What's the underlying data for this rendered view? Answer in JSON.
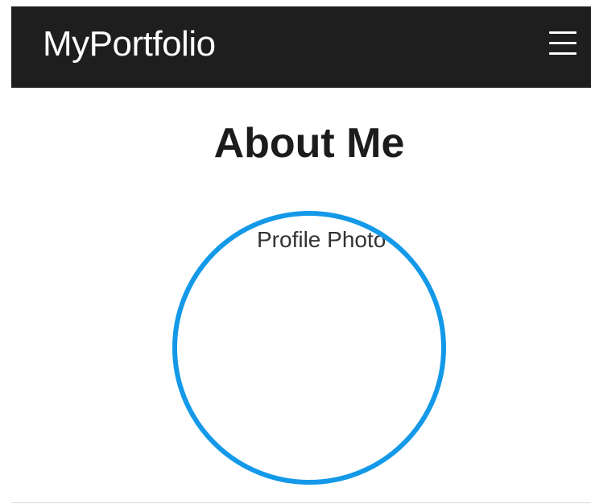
{
  "navbar": {
    "brand": "MyPortfolio",
    "menu_icon": "hamburger-menu-icon"
  },
  "about": {
    "title": "About Me",
    "profile_photo_label": "Profile Photo"
  },
  "colors": {
    "navbar_background": "#1e1e1e",
    "accent": "#1399e8",
    "heading": "#1c1c1c"
  }
}
